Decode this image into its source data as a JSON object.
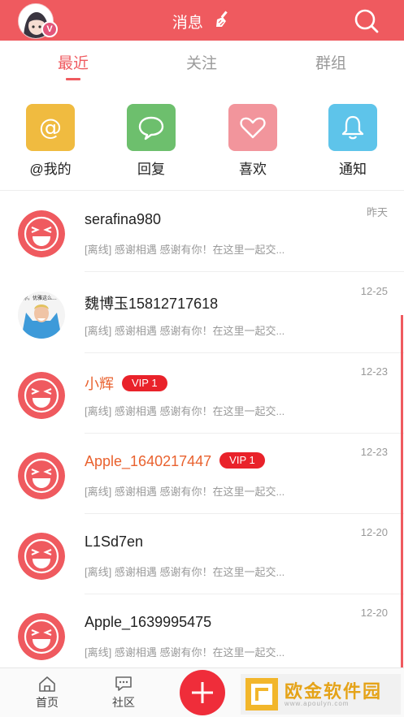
{
  "header": {
    "title": "消息",
    "avatar_badge": "V"
  },
  "tabs": [
    {
      "label": "最近",
      "active": true
    },
    {
      "label": "关注",
      "active": false
    },
    {
      "label": "群组",
      "active": false
    }
  ],
  "quick_actions": [
    {
      "label": "@我的",
      "icon": "at-icon",
      "color": "#f0bb40"
    },
    {
      "label": "回复",
      "icon": "chat-bubble-icon",
      "color": "#6dbf6d"
    },
    {
      "label": "喜欢",
      "icon": "heart-icon",
      "color": "#f2959c"
    },
    {
      "label": "通知",
      "icon": "bell-icon",
      "color": "#5ec4ea"
    }
  ],
  "messages": [
    {
      "name": "serafina980",
      "vip": false,
      "vip_label": "",
      "preview": "[离线] 感谢相遇 感谢有你！在这里一起交...",
      "time": "昨天",
      "avatar": "laughing-face"
    },
    {
      "name": "魏博玉15812717618",
      "vip": false,
      "vip_label": "",
      "preview": "[离线] 感谢相遇 感谢有你！在这里一起交...",
      "time": "12-25",
      "avatar": "photo"
    },
    {
      "name": "小辉",
      "vip": true,
      "vip_label": "VIP 1",
      "preview": "[离线] 感谢相遇 感谢有你！在这里一起交...",
      "time": "12-23",
      "avatar": "laughing-face"
    },
    {
      "name": "Apple_1640217447",
      "vip": true,
      "vip_label": "VIP 1",
      "preview": "[离线] 感谢相遇 感谢有你！在这里一起交...",
      "time": "12-23",
      "avatar": "laughing-face"
    },
    {
      "name": "L1Sd7en",
      "vip": false,
      "vip_label": "",
      "preview": "[离线] 感谢相遇 感谢有你！在这里一起交...",
      "time": "12-20",
      "avatar": "laughing-face"
    },
    {
      "name": "Apple_1639995475",
      "vip": false,
      "vip_label": "",
      "preview": "[离线] 感谢相遇 感谢有你！在这里一起交...",
      "time": "12-20",
      "avatar": "laughing-face"
    }
  ],
  "bottom_nav": [
    {
      "label": "首页",
      "icon": "home-icon"
    },
    {
      "label": "社区",
      "icon": "community-icon"
    }
  ],
  "watermark": {
    "title": "欧金软件园",
    "sub": "www.apoulyn.com"
  },
  "colors": {
    "brand": "#ef5a5f",
    "vip_name": "#e9622f",
    "vip_badge": "#e9222a",
    "add_button": "#ef2d3a"
  }
}
